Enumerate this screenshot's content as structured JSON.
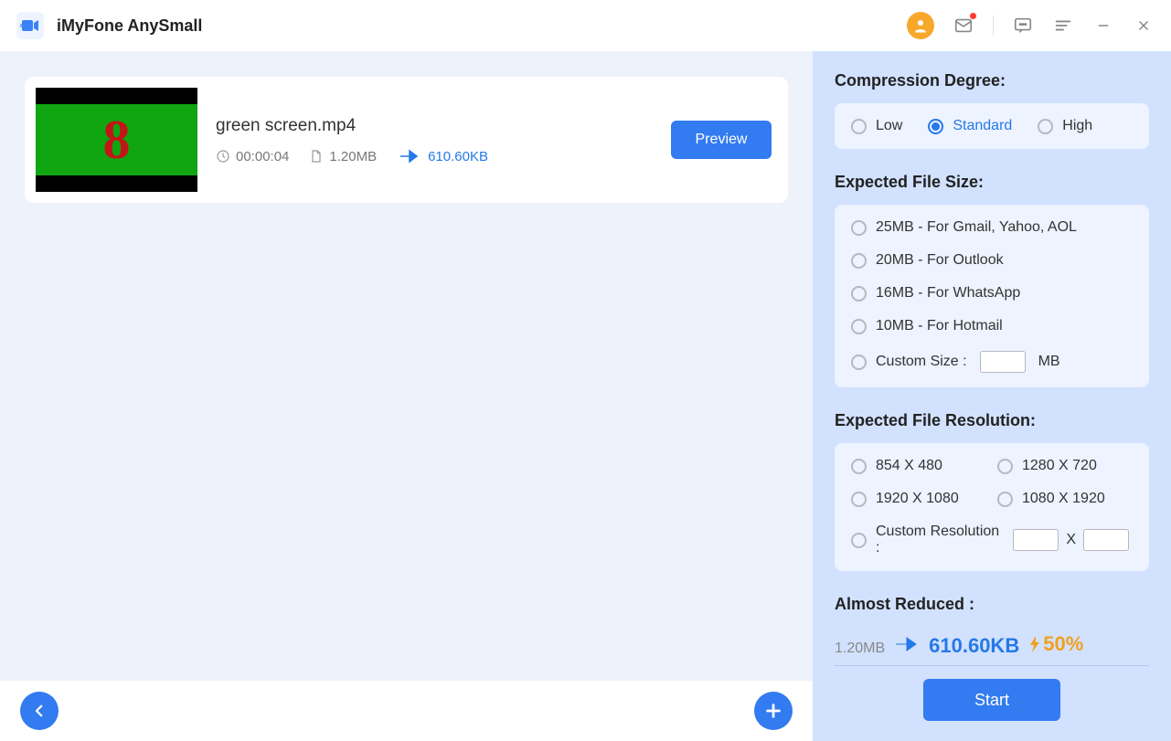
{
  "app": {
    "title": "iMyFone AnySmall"
  },
  "video": {
    "name": "green screen.mp4",
    "duration": "00:00:04",
    "size": "1.20MB",
    "out_size": "610.60KB",
    "preview_label": "Preview",
    "thumb_digit": "8"
  },
  "panel": {
    "compression": {
      "title": "Compression Degree:",
      "options": {
        "low": "Low",
        "standard": "Standard",
        "high": "High"
      }
    },
    "expected_size": {
      "title": "Expected File Size:",
      "items": [
        "25MB - For Gmail, Yahoo, AOL",
        "20MB - For Outlook",
        "16MB - For WhatsApp",
        "10MB - For Hotmail"
      ],
      "custom_label": "Custom Size :",
      "custom_unit": "MB"
    },
    "resolution": {
      "title": "Expected File Resolution:",
      "r1": "854 X 480",
      "r2": "1280 X 720",
      "r3": "1920 X 1080",
      "r4": "1080 X 1920",
      "custom_label": "Custom Resolution :",
      "sep": "X"
    },
    "reduced": {
      "title": "Almost Reduced :",
      "from": "1.20MB",
      "to": "610.60KB",
      "pct": "50%"
    },
    "start_label": "Start"
  }
}
